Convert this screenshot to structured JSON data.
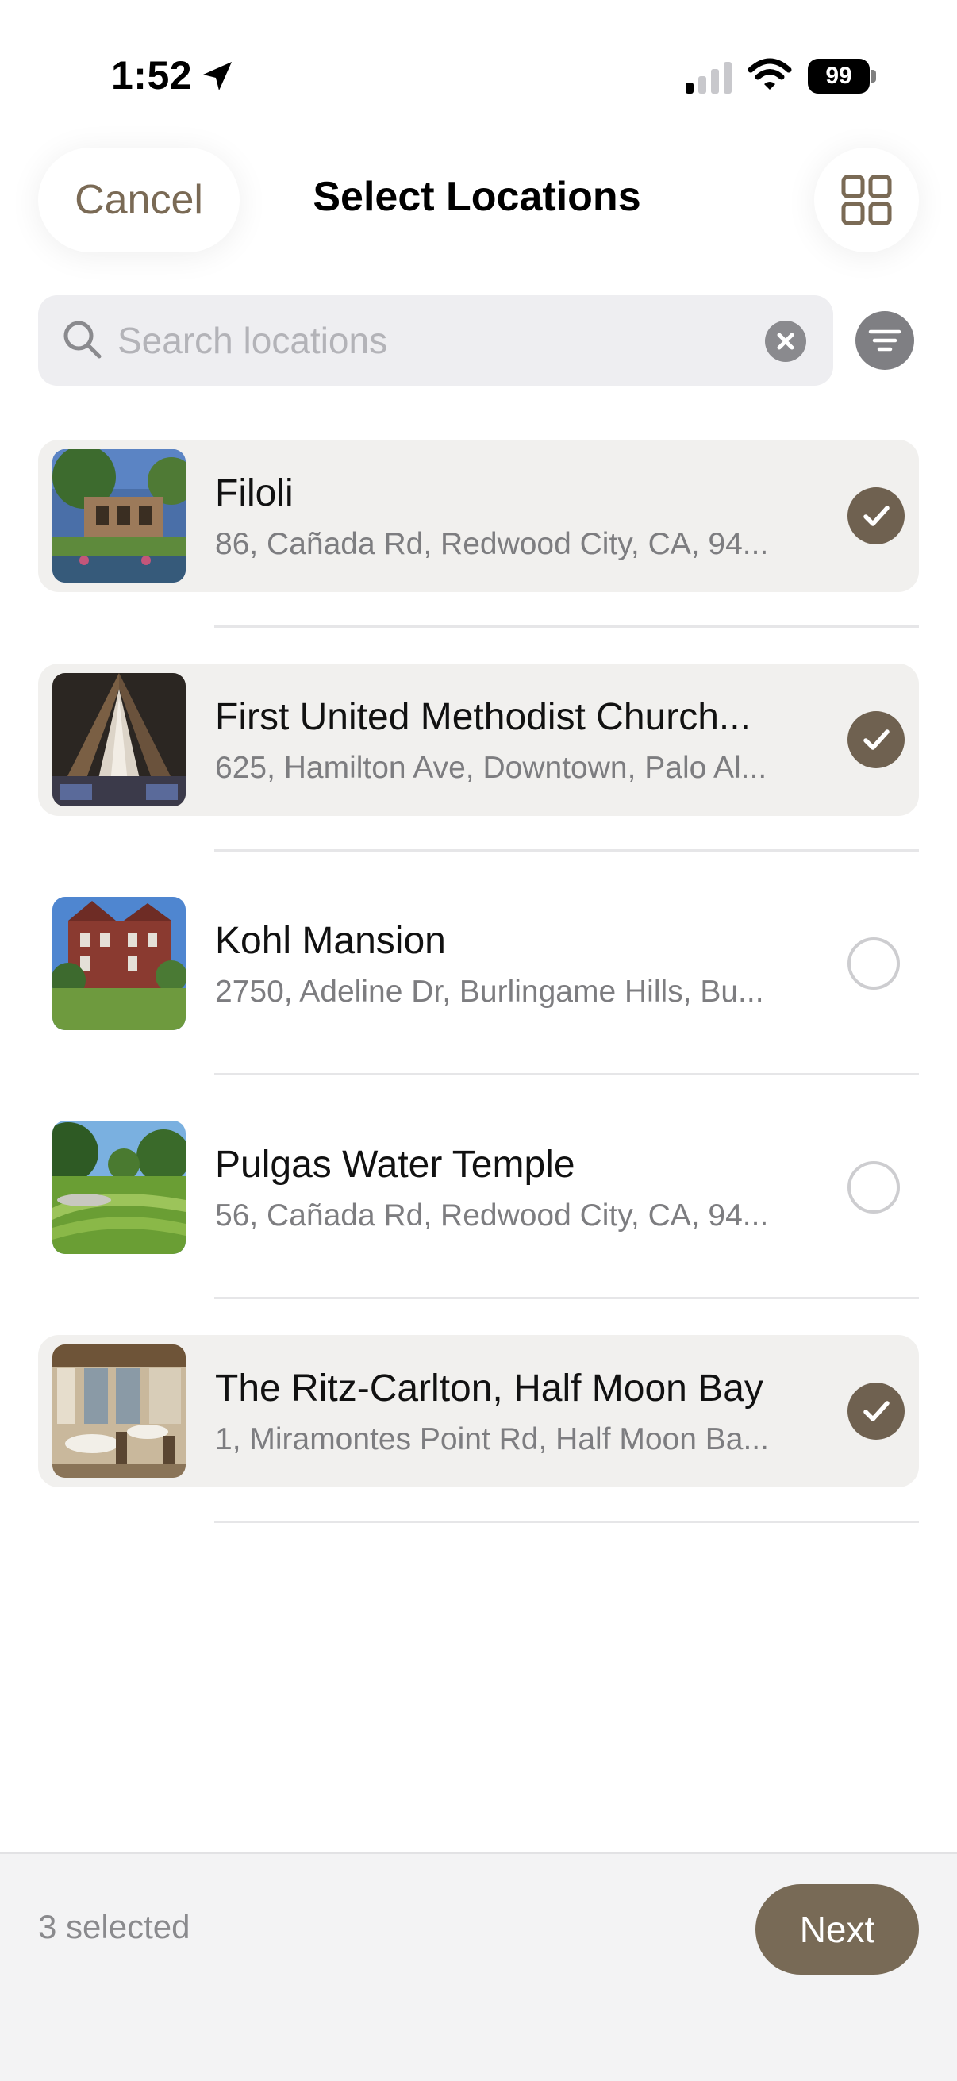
{
  "status_bar": {
    "time": "1:52",
    "battery": "99",
    "icons": [
      "location-arrow-icon",
      "signal-icon",
      "wifi-icon",
      "battery-icon"
    ]
  },
  "header": {
    "cancel_label": "Cancel",
    "title": "Select Locations",
    "grid_icon": "grid-view-icon"
  },
  "search": {
    "placeholder": "Search locations",
    "value": "",
    "icon": "search-icon",
    "clear_icon": "clear-icon",
    "filter_icon": "filter-icon"
  },
  "locations": [
    {
      "name": "Filoli",
      "address": "86, Cañada Rd, Redwood City, CA, 94...",
      "selected": true
    },
    {
      "name": "First United Methodist Church...",
      "address": "625, Hamilton Ave, Downtown, Palo Al...",
      "selected": true
    },
    {
      "name": "Kohl Mansion",
      "address": "2750, Adeline Dr, Burlingame Hills, Bu...",
      "selected": false
    },
    {
      "name": "Pulgas Water Temple",
      "address": "56, Cañada Rd, Redwood City, CA, 94...",
      "selected": false
    },
    {
      "name": "The Ritz-Carlton, Half Moon Bay",
      "address": "1, Miramontes Point Rd, Half Moon Ba...",
      "selected": true
    }
  ],
  "footer": {
    "selected_count": "3 selected",
    "next_label": "Next"
  },
  "colors": {
    "accent": "#786a56",
    "check": "#6f6150",
    "selected_row": "#f1f0ee"
  }
}
